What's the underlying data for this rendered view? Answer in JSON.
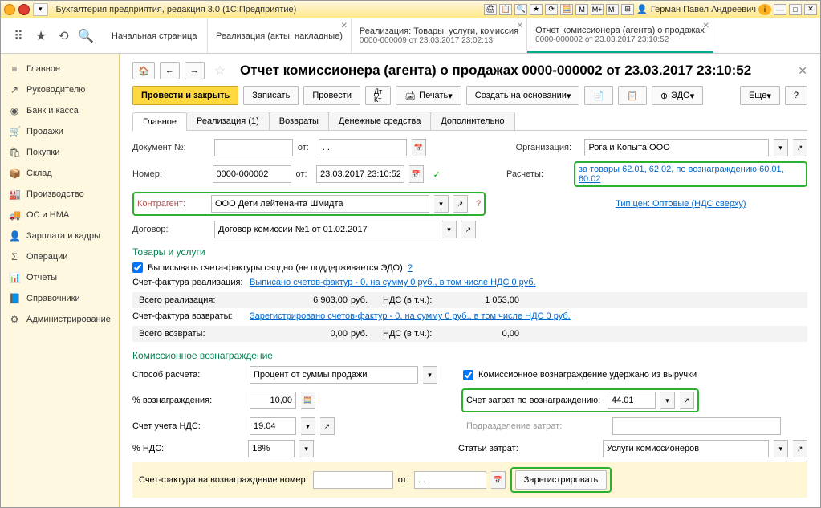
{
  "titlebar": {
    "app_title": "Бухгалтерия предприятия, редакция 3.0 (1С:Предприятие)",
    "user": "Герман Павел Андреевич",
    "m_buttons": [
      "M",
      "M+",
      "M-"
    ],
    "info_icon": "i"
  },
  "tabs": [
    {
      "label": "Начальная страница",
      "sub": ""
    },
    {
      "label": "Реализация (акты, накладные)",
      "sub": ""
    },
    {
      "label": "Реализация: Товары, услуги, комиссия",
      "sub": "0000-000009 от 23.03.2017 23:02:13"
    },
    {
      "label": "Отчет комиссионера (агента) о продажах",
      "sub": "0000-000002 от 23.03.2017 23:10:52",
      "active": true
    }
  ],
  "sidebar": [
    {
      "icon": "≡",
      "label": "Главное"
    },
    {
      "icon": "↗",
      "label": "Руководителю"
    },
    {
      "icon": "◉",
      "label": "Банк и касса"
    },
    {
      "icon": "🛒",
      "label": "Продажи"
    },
    {
      "icon": "🛍",
      "label": "Покупки"
    },
    {
      "icon": "📦",
      "label": "Склад"
    },
    {
      "icon": "🏭",
      "label": "Производство"
    },
    {
      "icon": "🚚",
      "label": "ОС и НМА"
    },
    {
      "icon": "👤",
      "label": "Зарплата и кадры"
    },
    {
      "icon": "Σ",
      "label": "Операции"
    },
    {
      "icon": "📊",
      "label": "Отчеты"
    },
    {
      "icon": "📘",
      "label": "Справочники"
    },
    {
      "icon": "⚙",
      "label": "Администрирование"
    }
  ],
  "page": {
    "title": "Отчет комиссионера (агента) о продажах 0000-000002 от 23.03.2017 23:10:52",
    "actions": {
      "post_close": "Провести и закрыть",
      "write": "Записать",
      "post": "Провести",
      "print": "Печать",
      "create_based": "Создать на основании",
      "edo": "ЭДО",
      "more": "Еще"
    },
    "subtabs": [
      "Главное",
      "Реализация (1)",
      "Возвраты",
      "Денежные средства",
      "Дополнительно"
    ]
  },
  "form": {
    "doc_num_label": "Документ №:",
    "doc_num": "",
    "from1_label": "от:",
    "from1": ". .",
    "org_label": "Организация:",
    "org": "Рога и Копыта ООО",
    "number_label": "Номер:",
    "number": "0000-000002",
    "from2_label": "от:",
    "from2": "23.03.2017 23:10:52",
    "calc_label": "Расчеты:",
    "calc_link": "за товары 62.01, 62.02, по вознаграждению 60.01, 60.02",
    "contragent_label": "Контрагент:",
    "contragent": "ООО Дети лейтенанта Шмидта",
    "price_type_link": "Тип цен: Оптовые (НДС сверху)",
    "contract_label": "Договор:",
    "contract": "Договор комиссии №1 от 01.02.2017"
  },
  "goods": {
    "section": "Товары и услуги",
    "checkbox": "Выписывать счета-фактуры сводно (не поддерживается ЭДО)",
    "sf_real_label": "Счет-фактура реализация:",
    "sf_real_link": "Выписано счетов-фактур - 0, на сумму 0 руб., в том числе НДС 0 руб.",
    "total_real_label": "Всего реализация:",
    "total_real_amount": "6 903,00",
    "rub": "руб.",
    "nds_label": "НДС (в т.ч.):",
    "total_real_nds": "1 053,00",
    "sf_ret_label": "Счет-фактура возвраты:",
    "sf_ret_link": "Зарегистрировано счетов-фактур - 0, на сумму 0 руб., в том числе НДС 0 руб.",
    "total_ret_label": "Всего возвраты:",
    "total_ret_amount": "0,00",
    "total_ret_nds": "0,00"
  },
  "commission": {
    "section": "Комиссионное вознаграждение",
    "method_label": "Способ расчета:",
    "method": "Процент от суммы продажи",
    "held_checkbox": "Комиссионное вознаграждение удержано из выручки",
    "percent_label": "% вознаграждения:",
    "percent": "10,00",
    "cost_account_label": "Счет затрат по вознаграждению:",
    "cost_account": "44.01",
    "nds_account_label": "Счет учета НДС:",
    "nds_account": "19.04",
    "division_label": "Подразделение затрат:",
    "division": "",
    "nds_pct_label": "% НДС:",
    "nds_pct": "18%",
    "cost_item_label": "Статьи затрат:",
    "cost_item": "Услуги комиссионеров",
    "sf_label": "Счет-фактура на вознаграждение номер:",
    "sf_from": "от:",
    "sf_date": ". .",
    "register_btn": "Зарегистрировать"
  }
}
